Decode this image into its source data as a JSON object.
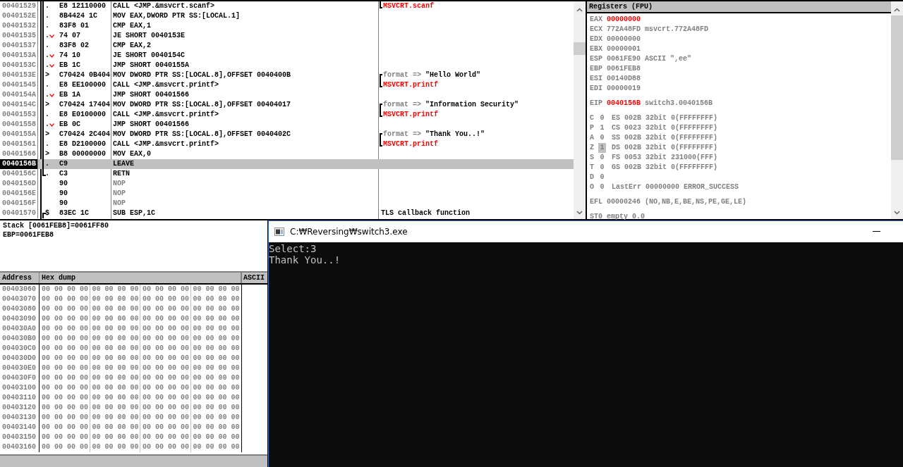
{
  "disassembly": {
    "rows": [
      {
        "address": "00401529",
        "mark": ".",
        "jump": false,
        "block": true,
        "block_end": false,
        "block_start": false,
        "hex": "E8 12110000",
        "asm": "CALL <JMP.&msvcrt.scanf>",
        "kind": "code",
        "selected": false,
        "comment": {
          "kind": "call",
          "text": "MSVCRT.scanf"
        }
      },
      {
        "address": "0040152E",
        "mark": ".",
        "jump": false,
        "block": true,
        "block_end": false,
        "block_start": false,
        "hex": "8B4424 1C",
        "asm": "MOV EAX,DWORD PTR SS:[LOCAL.1]",
        "kind": "code",
        "selected": false
      },
      {
        "address": "00401532",
        "mark": ".",
        "jump": false,
        "block": true,
        "block_end": false,
        "block_start": false,
        "hex": "83F8 01",
        "asm": "CMP EAX,1",
        "kind": "code",
        "selected": false
      },
      {
        "address": "00401535",
        "mark": ".",
        "jump": true,
        "block": true,
        "block_end": false,
        "block_start": false,
        "hex": "74 07",
        "asm": "JE SHORT 0040153E",
        "kind": "code",
        "selected": false
      },
      {
        "address": "00401537",
        "mark": ".",
        "jump": false,
        "block": true,
        "block_end": false,
        "block_start": false,
        "hex": "83F8 02",
        "asm": "CMP EAX,2",
        "kind": "code",
        "selected": false
      },
      {
        "address": "0040153A",
        "mark": ".",
        "jump": true,
        "block": true,
        "block_end": false,
        "block_start": false,
        "hex": "74 10",
        "asm": "JE SHORT 0040154C",
        "kind": "code",
        "selected": false
      },
      {
        "address": "0040153C",
        "mark": ".",
        "jump": true,
        "block": true,
        "block_end": false,
        "block_start": false,
        "hex": "EB 1C",
        "asm": "JMP SHORT 0040155A",
        "kind": "code",
        "selected": false
      },
      {
        "address": "0040153E",
        "mark": ">",
        "jump": false,
        "block": true,
        "block_end": false,
        "block_start": false,
        "hex": "C70424 0B404",
        "asm": "MOV DWORD PTR SS:[LOCAL.8],OFFSET 0040400B",
        "kind": "code",
        "selected": false,
        "comment": {
          "kind": "arg",
          "label": "format =>",
          "text": "\"Hello World\""
        }
      },
      {
        "address": "00401545",
        "mark": ".",
        "jump": false,
        "block": true,
        "block_end": false,
        "block_start": false,
        "hex": "E8 EE100000",
        "asm": "CALL <JMP.&msvcrt.printf>",
        "kind": "code",
        "selected": false,
        "comment": {
          "kind": "call",
          "text": "MSVCRT.printf"
        }
      },
      {
        "address": "0040154A",
        "mark": ".",
        "jump": true,
        "block": true,
        "block_end": false,
        "block_start": false,
        "hex": "EB 1A",
        "asm": "JMP SHORT 00401566",
        "kind": "code",
        "selected": false
      },
      {
        "address": "0040154C",
        "mark": ">",
        "jump": false,
        "block": true,
        "block_end": false,
        "block_start": false,
        "hex": "C70424 17404",
        "asm": "MOV DWORD PTR SS:[LOCAL.8],OFFSET 00404017",
        "kind": "code",
        "selected": false,
        "comment": {
          "kind": "arg",
          "label": "format =>",
          "text": "\"Information Security\""
        }
      },
      {
        "address": "00401553",
        "mark": ".",
        "jump": false,
        "block": true,
        "block_end": false,
        "block_start": false,
        "hex": "E8 E0100000",
        "asm": "CALL <JMP.&msvcrt.printf>",
        "kind": "code",
        "selected": false,
        "comment": {
          "kind": "call",
          "text": "MSVCRT.printf"
        }
      },
      {
        "address": "00401558",
        "mark": ".",
        "jump": true,
        "block": true,
        "block_end": false,
        "block_start": false,
        "hex": "EB 0C",
        "asm": "JMP SHORT 00401566",
        "kind": "code",
        "selected": false
      },
      {
        "address": "0040155A",
        "mark": ">",
        "jump": false,
        "block": true,
        "block_end": false,
        "block_start": false,
        "hex": "C70424 2C404",
        "asm": "MOV DWORD PTR SS:[LOCAL.8],OFFSET 0040402C",
        "kind": "code",
        "selected": false,
        "comment": {
          "kind": "arg",
          "label": "format =>",
          "text": "\"Thank You..!\""
        }
      },
      {
        "address": "00401561",
        "mark": ".",
        "jump": false,
        "block": true,
        "block_end": false,
        "block_start": false,
        "hex": "E8 D2100000",
        "asm": "CALL <JMP.&msvcrt.printf>",
        "kind": "code",
        "selected": false,
        "comment": {
          "kind": "call",
          "text": "MSVCRT.printf"
        }
      },
      {
        "address": "00401566",
        "mark": ">",
        "jump": false,
        "block": true,
        "block_end": false,
        "block_start": false,
        "hex": "B8 00000000",
        "asm": "MOV EAX,0",
        "kind": "code",
        "selected": false
      },
      {
        "address": "0040156B",
        "mark": ".",
        "jump": false,
        "block": true,
        "block_end": false,
        "block_start": false,
        "hex": "C9",
        "asm": "LEAVE",
        "kind": "code",
        "selected": true
      },
      {
        "address": "0040156C",
        "mark": ".",
        "jump": false,
        "block": false,
        "block_end": true,
        "block_start": false,
        "hex": "C3",
        "asm": "RETN",
        "kind": "code",
        "selected": false
      },
      {
        "address": "0040156D",
        "jump": false,
        "block": false,
        "block_end": false,
        "block_start": false,
        "hex": "90",
        "asm": "NOP",
        "kind": "nop",
        "selected": false
      },
      {
        "address": "0040156E",
        "jump": false,
        "block": false,
        "block_end": false,
        "block_start": false,
        "hex": "90",
        "asm": "NOP",
        "kind": "nop",
        "selected": false
      },
      {
        "address": "0040156F",
        "jump": false,
        "block": false,
        "block_end": false,
        "block_start": false,
        "hex": "90",
        "asm": "NOP",
        "kind": "nop",
        "selected": false
      },
      {
        "address": "00401570",
        "mark": "$",
        "jump": false,
        "block": false,
        "block_end": false,
        "block_start": true,
        "hex": "83EC 1C",
        "asm": "SUB ESP,1C",
        "kind": "code",
        "selected": false,
        "comment": {
          "kind": "text",
          "text": "TLS callback function"
        }
      }
    ]
  },
  "registers": {
    "title": "Registers (FPU)",
    "general": [
      {
        "name": "EAX",
        "value": "00000000",
        "changed": true
      },
      {
        "name": "ECX",
        "value": "772A48FD",
        "changed": false,
        "info": "msvcrt.772A48FD"
      },
      {
        "name": "EDX",
        "value": "00000000",
        "changed": false
      },
      {
        "name": "EBX",
        "value": "00000001",
        "changed": false
      },
      {
        "name": "ESP",
        "value": "0061FE90",
        "changed": false,
        "info": "ASCII \",ee\""
      },
      {
        "name": "EBP",
        "value": "0061FEB8",
        "changed": false
      },
      {
        "name": "ESI",
        "value": "00140D88",
        "changed": false
      },
      {
        "name": "EDI",
        "value": "00000019",
        "changed": false
      }
    ],
    "eip": {
      "name": "EIP",
      "value": "0040156B",
      "changed": true,
      "info": "switch3.0040156B"
    },
    "flags": [
      {
        "flag": "C",
        "value": "0",
        "highlighted": false,
        "extra": "ES 002B 32bit 0(FFFFFFFF)"
      },
      {
        "flag": "P",
        "value": "1",
        "highlighted": false,
        "extra": "CS 0023 32bit 0(FFFFFFFF)"
      },
      {
        "flag": "A",
        "value": "0",
        "highlighted": false,
        "extra": "SS 002B 32bit 0(FFFFFFFF)"
      },
      {
        "flag": "Z",
        "value": "1",
        "highlighted": true,
        "extra": "DS 002B 32bit 0(FFFFFFFF)"
      },
      {
        "flag": "S",
        "value": "0",
        "highlighted": false,
        "extra": "FS 0053 32bit 231000(FFF)"
      },
      {
        "flag": "T",
        "value": "0",
        "highlighted": false,
        "extra": "GS 002B 32bit 0(FFFFFFFF)"
      },
      {
        "flag": "D",
        "value": "0",
        "highlighted": false
      },
      {
        "flag": "O",
        "value": "0",
        "highlighted": false,
        "extra": "LastErr 00000000 ERROR_SUCCESS"
      }
    ],
    "efl": {
      "name": "EFL",
      "value": "00000246",
      "info": "(NO,NB,E,BE,NS,PE,GE,LE)"
    },
    "fpu": [
      {
        "name": "ST0",
        "value": "empty 0.0"
      }
    ]
  },
  "info": {
    "lines": [
      "Stack [0061FEB8]=0061FF80",
      "EBP=0061FEB8"
    ]
  },
  "dump": {
    "columns": [
      "Address",
      "Hex dump",
      "ASCII"
    ],
    "rows": [
      {
        "address": "00403060",
        "groups": [
          "00 00 00 00",
          "00 00 00 00",
          "00 00 00 00",
          "00 00 00 00"
        ]
      },
      {
        "address": "00403070",
        "groups": [
          "00 00 00 00",
          "00 00 00 00",
          "00 00 00 00",
          "00 00 00 00"
        ]
      },
      {
        "address": "00403080",
        "groups": [
          "00 00 00 00",
          "00 00 00 00",
          "00 00 00 00",
          "00 00 00 00"
        ]
      },
      {
        "address": "00403090",
        "groups": [
          "00 00 00 00",
          "00 00 00 00",
          "00 00 00 00",
          "00 00 00 00"
        ]
      },
      {
        "address": "004030A0",
        "groups": [
          "00 00 00 00",
          "00 00 00 00",
          "00 00 00 00",
          "00 00 00 00"
        ]
      },
      {
        "address": "004030B0",
        "groups": [
          "00 00 00 00",
          "00 00 00 00",
          "00 00 00 00",
          "00 00 00 00"
        ]
      },
      {
        "address": "004030C0",
        "groups": [
          "00 00 00 00",
          "00 00 00 00",
          "00 00 00 00",
          "00 00 00 00"
        ]
      },
      {
        "address": "004030D0",
        "groups": [
          "00 00 00 00",
          "00 00 00 00",
          "00 00 00 00",
          "00 00 00 00"
        ]
      },
      {
        "address": "004030E0",
        "groups": [
          "00 00 00 00",
          "00 00 00 00",
          "00 00 00 00",
          "00 00 00 00"
        ]
      },
      {
        "address": "004030F0",
        "groups": [
          "00 00 00 00",
          "00 00 00 00",
          "00 00 00 00",
          "00 00 00 00"
        ]
      },
      {
        "address": "00403100",
        "groups": [
          "00 00 00 00",
          "00 00 00 00",
          "00 00 00 00",
          "00 00 00 00"
        ]
      },
      {
        "address": "00403110",
        "groups": [
          "00 00 00 00",
          "00 00 00 00",
          "00 00 00 00",
          "00 00 00 00"
        ]
      },
      {
        "address": "00403120",
        "groups": [
          "00 00 00 00",
          "00 00 00 00",
          "00 00 00 00",
          "00 00 00 00"
        ]
      },
      {
        "address": "00403130",
        "groups": [
          "00 00 00 00",
          "00 00 00 00",
          "00 00 00 00",
          "00 00 00 00"
        ]
      },
      {
        "address": "00403140",
        "groups": [
          "00 00 00 00",
          "00 00 00 00",
          "00 00 00 00",
          "00 00 00 00"
        ]
      },
      {
        "address": "00403150",
        "groups": [
          "00 00 00 00",
          "00 00 00 00",
          "00 00 00 00",
          "00 00 00 00"
        ]
      },
      {
        "address": "00403160",
        "groups": [
          "00 00 00 00",
          "00 00 00 00",
          "00 00 00 00",
          "00 00 00 00"
        ]
      }
    ]
  },
  "console": {
    "title": "C:₩Reversing₩switch3.exe",
    "lines": [
      "Select:3",
      "Thank You..!"
    ]
  }
}
